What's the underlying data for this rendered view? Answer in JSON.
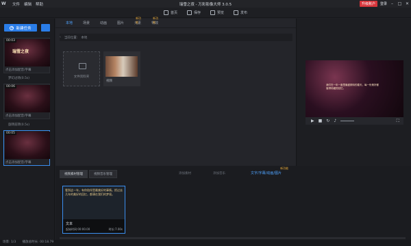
{
  "titlebar": {
    "menus": [
      "文件",
      "编辑",
      "帮助"
    ],
    "title": "瑞雪之夜 - 万彩影像大师 3.0.5",
    "upgrade": "升级账户",
    "login": "登录"
  },
  "toolbar": [
    "首页",
    "保存",
    "预览",
    "发布"
  ],
  "left": {
    "new_task": "新建任务",
    "clips": [
      {
        "duration": "00:03",
        "title": "瑞雪之夜",
        "caption": "点击添加配音/字幕"
      },
      {
        "duration": "00:06",
        "title": "",
        "caption": "点击添加配音/字幕"
      },
      {
        "duration": "00:05",
        "title": "",
        "caption": "点击添加配音/字幕"
      }
    ],
    "transitions": [
      "梦幻过场(0.5s)",
      "旋转前转(0.5s)"
    ],
    "page_info": "场景: 1/3",
    "total_time": "播放总时长: 00:18.79"
  },
  "tabs": [
    {
      "label": "本地",
      "badge": ""
    },
    {
      "label": "场景",
      "badge": ""
    },
    {
      "label": "动画",
      "badge": ""
    },
    {
      "label": "图片",
      "badge": ""
    },
    {
      "label": "元素",
      "badge": "新功能"
    },
    {
      "label": "特效",
      "badge": "新功能"
    }
  ],
  "path": {
    "label": "当前位置:",
    "value": "本地"
  },
  "media": {
    "import_label": "文件资料夹",
    "item_label": "视频"
  },
  "preview": {
    "caption": "我们在一年一度里最盛期待的春天，每一份美好都值得珍藏的回忆。"
  },
  "bottom": {
    "tabs": [
      "视频素材管理",
      "视频音乐管理"
    ],
    "dim_buttons": [
      "添加素材",
      "添加音乐"
    ],
    "text_button": "文字/字幕/动画/图片",
    "text_badge": "新功能",
    "track": {
      "text": "看到这一年，有你陪伴是最美好的事情。把过去几年的美好的回忆，都满在我们的梦境。",
      "name": "文本",
      "start": "起始时间:00:00.00",
      "time": "时长:7.00s"
    }
  }
}
